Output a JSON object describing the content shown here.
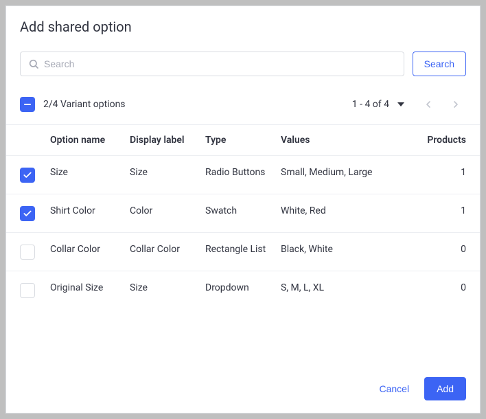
{
  "modal": {
    "title": "Add shared option"
  },
  "search": {
    "placeholder": "Search",
    "button": "Search",
    "value": ""
  },
  "controls": {
    "selection_label": "2/4 Variant options",
    "range": "1 - 4 of 4"
  },
  "table": {
    "headers": {
      "name": "Option name",
      "display": "Display label",
      "type": "Type",
      "values": "Values",
      "products": "Products"
    },
    "rows": [
      {
        "checked": true,
        "name": "Size",
        "display": "Size",
        "type": "Radio Buttons",
        "values": "Small, Medium, Large",
        "products": "1"
      },
      {
        "checked": true,
        "name": "Shirt Color",
        "display": "Color",
        "type": "Swatch",
        "values": "White, Red",
        "products": "1"
      },
      {
        "checked": false,
        "name": "Collar Color",
        "display": "Collar Color",
        "type": "Rectangle List",
        "values": "Black, White",
        "products": "0"
      },
      {
        "checked": false,
        "name": "Original Size",
        "display": "Size",
        "type": "Dropdown",
        "values": "S, M, L, XL",
        "products": "0"
      }
    ]
  },
  "footer": {
    "cancel": "Cancel",
    "add": "Add"
  },
  "colors": {
    "primary": "#3c64f4"
  }
}
